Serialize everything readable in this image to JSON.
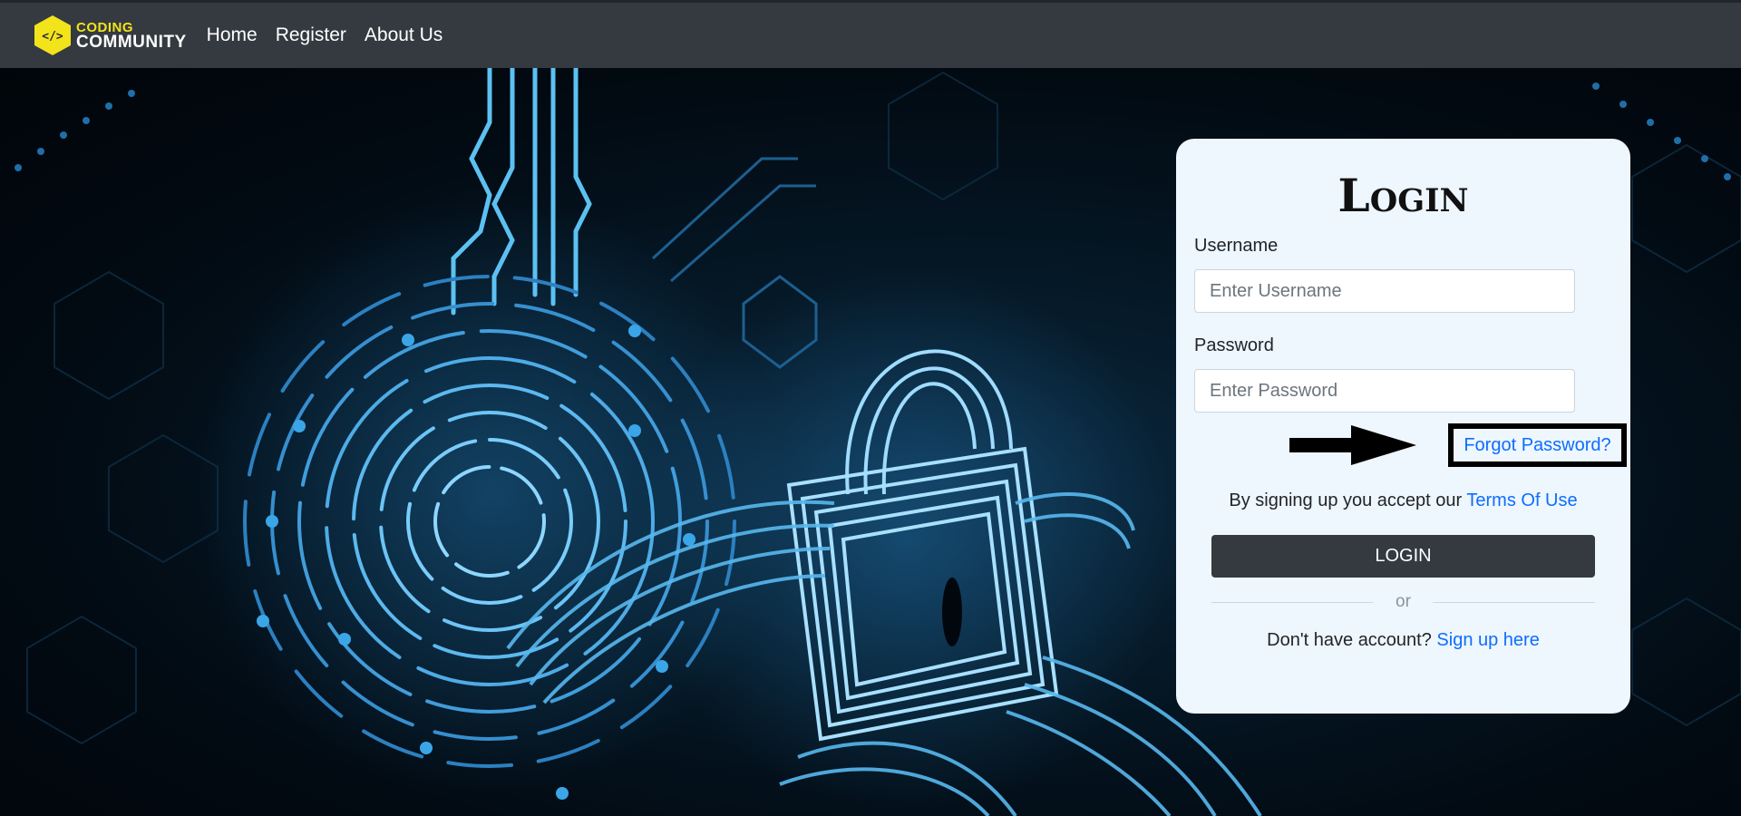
{
  "navbar": {
    "brand_line1": "CODING",
    "brand_line2": "COMMUNITY",
    "brand_icon": "code-brackets-icon",
    "links": [
      "Home",
      "Register",
      "About Us"
    ]
  },
  "login": {
    "title": "Login",
    "username_label": "Username",
    "username_placeholder": "Enter Username",
    "password_label": "Password",
    "password_placeholder": "Enter Password",
    "forgot_password": "Forgot Password?",
    "terms_prefix": "By signing up you accept our ",
    "terms_link": "Terms Of Use",
    "login_button": "LOGIN",
    "or_text": "or",
    "signup_prefix": "Don't have account? ",
    "signup_link": "Sign up here"
  },
  "colors": {
    "navbar_bg": "#343a40",
    "brand_yellow": "#f3e31a",
    "link_blue": "#0d6efd",
    "card_bg": "#eef6fe",
    "hero_accent": "#3aa6e8"
  }
}
